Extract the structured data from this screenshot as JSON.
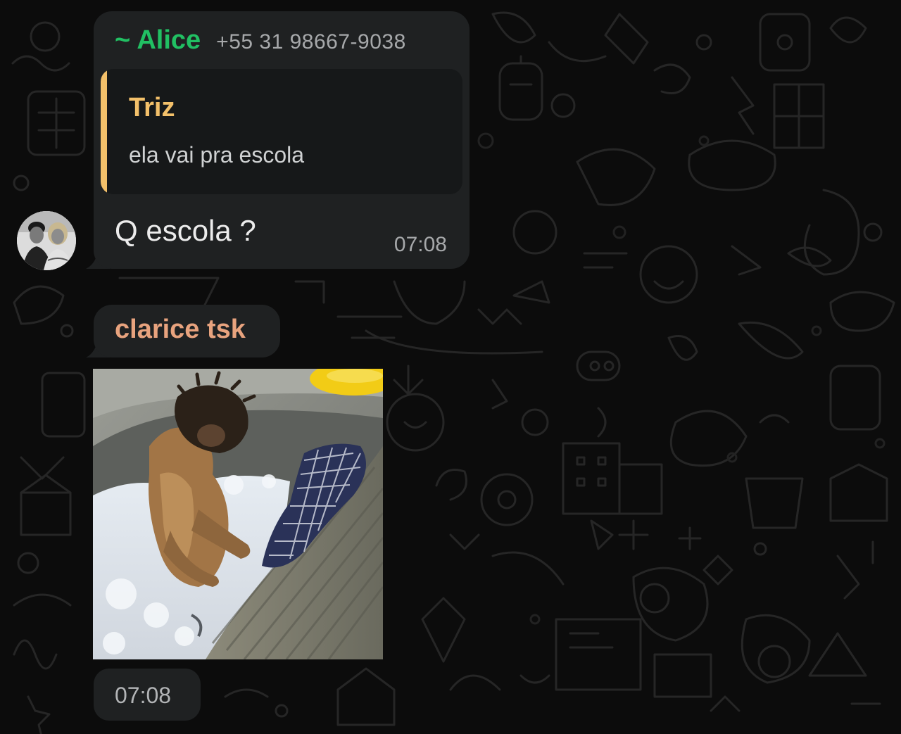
{
  "message1": {
    "sender_name": "~ Alice",
    "sender_phone": "+55 31 98667-9038",
    "quoted_author": "Triz",
    "quoted_text": "ela vai pra escola",
    "text": "Q escola ?",
    "time": "07:08"
  },
  "message2": {
    "sender_name": "clarice tsk",
    "time": "07:08"
  },
  "icons": [
    "avatar",
    "sticker-image",
    "wallpaper-doodles"
  ],
  "colors": {
    "background": "#0c0c0c",
    "bubble": "#1f2122",
    "quote_bg": "#161819",
    "sender_green": "#21c063",
    "quote_accent": "#f3c06a",
    "name_orange": "#e8a37e",
    "meta_gray": "#a6a8aa"
  }
}
